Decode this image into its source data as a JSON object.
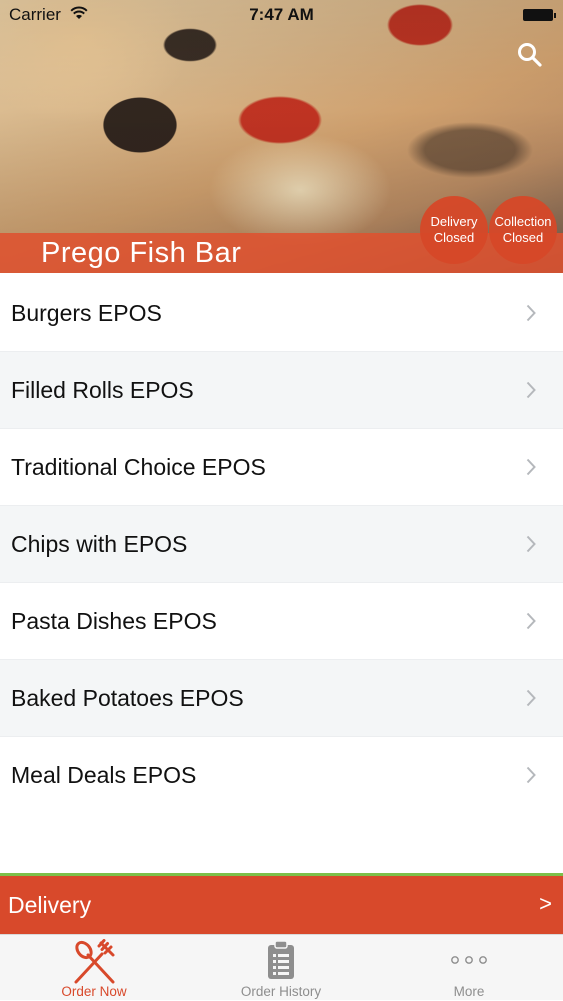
{
  "status_bar": {
    "carrier": "Carrier",
    "time": "7:47 AM"
  },
  "restaurant": {
    "name": "Prego Fish Bar",
    "delivery_status": {
      "line1": "Delivery",
      "line2": "Closed"
    },
    "collection_status": {
      "line1": "Collection",
      "line2": "Closed"
    }
  },
  "menu": {
    "items": [
      {
        "label": "Burgers EPOS"
      },
      {
        "label": "Filled Rolls EPOS"
      },
      {
        "label": "Traditional Choice EPOS"
      },
      {
        "label": "Chips with EPOS"
      },
      {
        "label": "Pasta Dishes EPOS"
      },
      {
        "label": "Baked Potatoes EPOS"
      },
      {
        "label": "Meal Deals EPOS"
      }
    ]
  },
  "order_mode": {
    "label": "Delivery",
    "arrow": ">"
  },
  "tab_bar": {
    "tabs": [
      {
        "label": "Order Now",
        "icon": "fork-spoon-icon"
      },
      {
        "label": "Order History",
        "icon": "clipboard-icon"
      },
      {
        "label": "More",
        "icon": "more-dots-icon"
      }
    ]
  },
  "colors": {
    "accent": "#d8492b",
    "divider_green": "#7cc04a",
    "inactive_tab": "#8e8e8e"
  }
}
